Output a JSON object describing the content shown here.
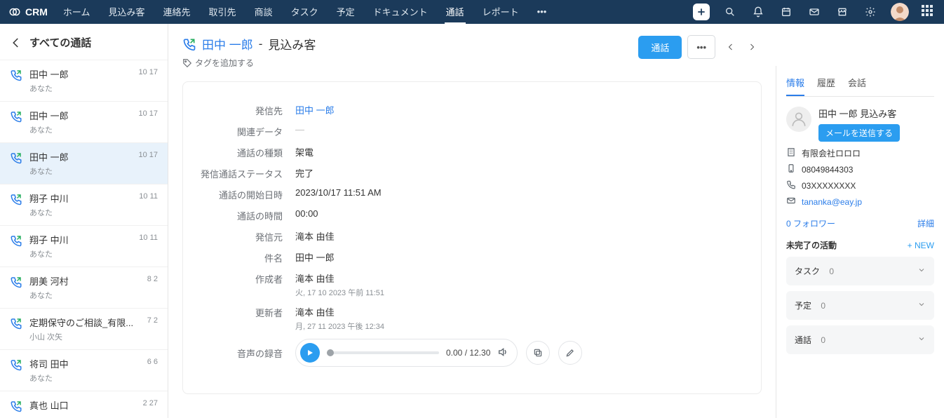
{
  "topnav": {
    "brand": "CRM",
    "items": [
      "ホーム",
      "見込み客",
      "連絡先",
      "取引先",
      "商談",
      "タスク",
      "予定",
      "ドキュメント",
      "通話",
      "レポート",
      "•••"
    ],
    "active_index": 8
  },
  "leftPanel": {
    "title": "すべての通話",
    "items": [
      {
        "title": "田中 一郎",
        "sub": "あなた",
        "date": "10 17",
        "dir": "out"
      },
      {
        "title": "田中 一郎",
        "sub": "あなた",
        "date": "10 17",
        "dir": "in"
      },
      {
        "title": "田中 一郎",
        "sub": "あなた",
        "date": "10 17",
        "dir": "out",
        "selected": true
      },
      {
        "title": "翔子 中川",
        "sub": "あなた",
        "date": "10 11",
        "dir": "out"
      },
      {
        "title": "翔子 中川",
        "sub": "あなた",
        "date": "10 11",
        "dir": "in"
      },
      {
        "title": "朋美 河村",
        "sub": "あなた",
        "date": "8 2",
        "dir": "out"
      },
      {
        "title": "定期保守のご相談_有限...",
        "sub": "小山 次矢",
        "date": "7 2",
        "dir": "in"
      },
      {
        "title": "将司 田中",
        "sub": "あなた",
        "date": "6 6",
        "dir": "out"
      },
      {
        "title": "真也 山口",
        "sub": "",
        "date": "2 27",
        "dir": "in"
      }
    ]
  },
  "record": {
    "head": {
      "person": "田中 一郎",
      "sep": " - ",
      "type": "見込み客",
      "addTag": "タグを追加する",
      "primaryBtn": "通話"
    },
    "details": {
      "labels": {
        "callTo": "発信先",
        "related": "関連データ",
        "callType": "通話の種類",
        "outStatus": "発信通話ステータス",
        "startTime": "通話の開始日時",
        "duration": "通話の時間",
        "from": "発信元",
        "subject": "件名",
        "creator": "作成者",
        "updater": "更新者",
        "recording": "音声の録音"
      },
      "values": {
        "callTo": "田中 一郎",
        "related": "—",
        "callType": "架電",
        "outStatus": "完了",
        "startTime": "2023/10/17 11:51 AM",
        "duration": "00:00",
        "from": "滝本 由佳",
        "subject": "田中 一郎",
        "creator": "滝本 由佳",
        "creatorSub": "火, 17 10 2023 午前 11:51",
        "updater": "滝本 由佳",
        "updaterSub": "月, 27 11 2023 午後 12:34",
        "playerTime": "0.00 / 12.30"
      }
    }
  },
  "rightPanel": {
    "tabs": [
      "情報",
      "履歴",
      "会話"
    ],
    "activeTab": 0,
    "profile": {
      "name": "田中 一郎 見込み客",
      "sendEmail": "メールを送信する",
      "company": "有限会社ロロロ",
      "mobile": "08049844303",
      "phone": "03XXXXXXXX",
      "email": "tananka@eay.jp"
    },
    "follow": {
      "followers": "0 フォロワー",
      "detail": "詳細"
    },
    "section": {
      "title": "未完了の活動",
      "add": "+ NEW",
      "items": [
        {
          "label": "タスク",
          "count": "0"
        },
        {
          "label": "予定",
          "count": "0"
        },
        {
          "label": "通話",
          "count": "0"
        }
      ]
    }
  }
}
